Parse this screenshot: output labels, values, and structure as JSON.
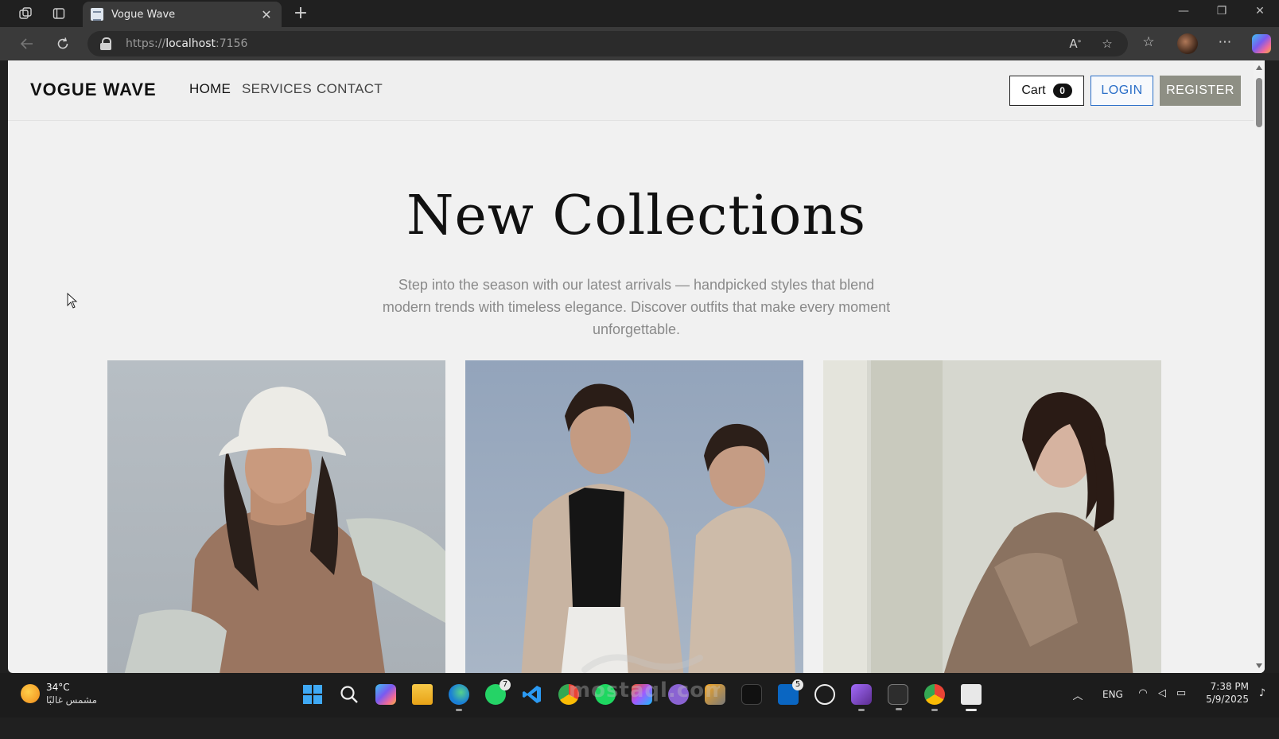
{
  "browser": {
    "tab_title": "Vogue Wave",
    "url_scheme": "https://",
    "url_host": "localhost",
    "url_port": ":7156"
  },
  "site": {
    "brand": "VOGUE WAVE",
    "nav": [
      {
        "label": "HOME"
      },
      {
        "label": "SERVICES"
      },
      {
        "label": "CONTACT"
      }
    ],
    "cart_label": "Cart",
    "cart_count": "0",
    "login_label": "LOGIN",
    "register_label": "REGISTER"
  },
  "hero": {
    "title": "New Collections",
    "subtitle": "Step into the season with our latest arrivals — handpicked styles that blend modern trends with timeless elegance. Discover outfits that make every moment unforgettable."
  },
  "taskbar": {
    "weather_temp": "34°C",
    "weather_desc": "مشمس غالبًا",
    "whatsapp_badge": "7",
    "linkedin_badge": "5",
    "language": "ENG",
    "time": "7:38 PM",
    "date": "5/9/2025"
  },
  "colors": {
    "accent_blue": "#2b6fc8",
    "register_bg": "#8e8f84",
    "page_bg": "#f1f1f1"
  }
}
